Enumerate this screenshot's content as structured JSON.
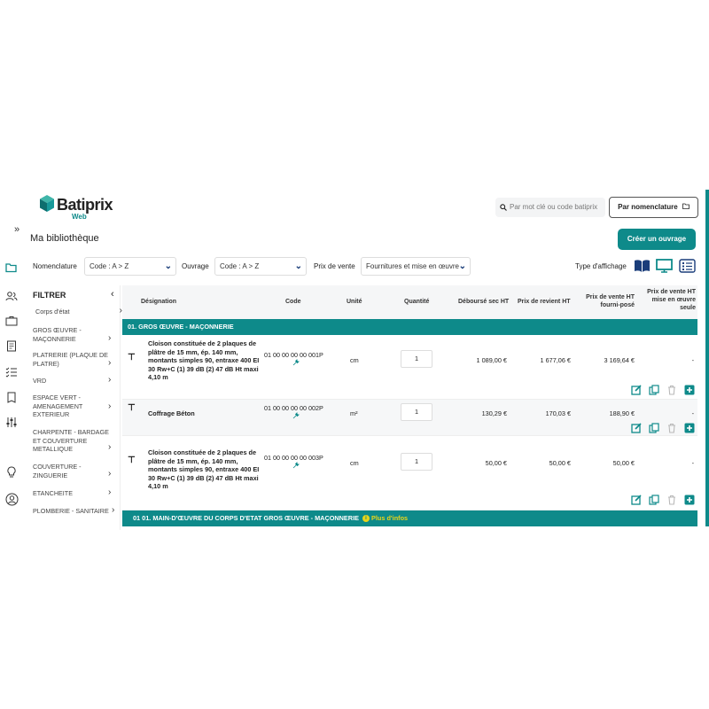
{
  "app": {
    "logo_text": "Batiprix",
    "logo_sub": "Web",
    "search_placeholder": "Par mot clé ou code batiprix",
    "nomenclature_button": "Par nomenclature",
    "expand_icon": "»",
    "page_title": "Ma bibliothèque",
    "create_button": "Créer un ouvrage"
  },
  "filters": {
    "nomenclature_label": "Nomenclature",
    "nomenclature_value": "Code : A > Z",
    "ouvrage_label": "Ouvrage",
    "ouvrage_value": "Code : A > Z",
    "prix_label": "Prix de vente",
    "prix_value": "Fournitures et mise en œuvre",
    "display_type_label": "Type d'affichage"
  },
  "sidebar": {
    "title": "FILTRER",
    "items": [
      {
        "label": "Corps d'état"
      },
      {
        "label": "GROS ŒUVRE - MAÇONNERIE"
      },
      {
        "label": "PLATRERIE (PLAQUE DE PLATRE)"
      },
      {
        "label": "VRD"
      },
      {
        "label": "ESPACE VERT - AMENAGEMENT EXTERIEUR"
      },
      {
        "label": "CHARPENTE - BARDAGE ET COUVERTURE METALLIQUE"
      },
      {
        "label": "COUVERTURE - ZINGUERIE"
      },
      {
        "label": "ETANCHEITE"
      },
      {
        "label": "PLOMBERIE - SANITAIRE"
      }
    ]
  },
  "table": {
    "headers": {
      "designation": "Désignation",
      "code": "Code",
      "unite": "Unité",
      "quantite": "Quantité",
      "debourse": "Déboursé sec HT",
      "revient": "Prix de revient HT",
      "vente_fp": "Prix de vente HT fourni-posé",
      "vente_moe": "Prix de vente HT mise en œuvre seule"
    },
    "group1": "01. GROS ŒUVRE - MAÇONNERIE",
    "rows": [
      {
        "designation": "Cloison constituée de 2 plaques de plâtre de 15 mm, ép. 140 mm, montants simples 90, entraxe 400 EI 30 Rw+C (1) 39 dB (2) 47 dB Ht maxi 4,10 m",
        "code": "01 00 00 00 00 001P",
        "unite": "cm",
        "quantite": "1",
        "debourse": "1 089,00 €",
        "revient": "1 677,06 €",
        "vente_fp": "3 169,64 €",
        "vente_moe": "-"
      },
      {
        "designation": "Coffrage Béton",
        "code": "01 00 00 00 00 002P",
        "unite": "m²",
        "quantite": "1",
        "debourse": "130,29 €",
        "revient": "170,03 €",
        "vente_fp": "188,90 €",
        "vente_moe": "-"
      },
      {
        "designation": "Cloison constituée de 2 plaques de plâtre de 15 mm, ép. 140 mm, montants simples 90, entraxe 400 EI 30 Rw+C (1) 39 dB (2) 47 dB Ht maxi 4,10 m",
        "code": "01 00 00 00 00 003P",
        "unite": "cm",
        "quantite": "1",
        "debourse": "50,00 €",
        "revient": "50,00 €",
        "vente_fp": "50,00 €",
        "vente_moe": "-"
      }
    ],
    "group2": "01 01. MAIN-D'ŒUVRE DU CORPS D'ETAT GROS ŒUVRE - MAÇONNERIE",
    "group2_info": "Plus d'infos"
  },
  "colors": {
    "accent": "#0e8a8a",
    "info": "#e8d419"
  }
}
